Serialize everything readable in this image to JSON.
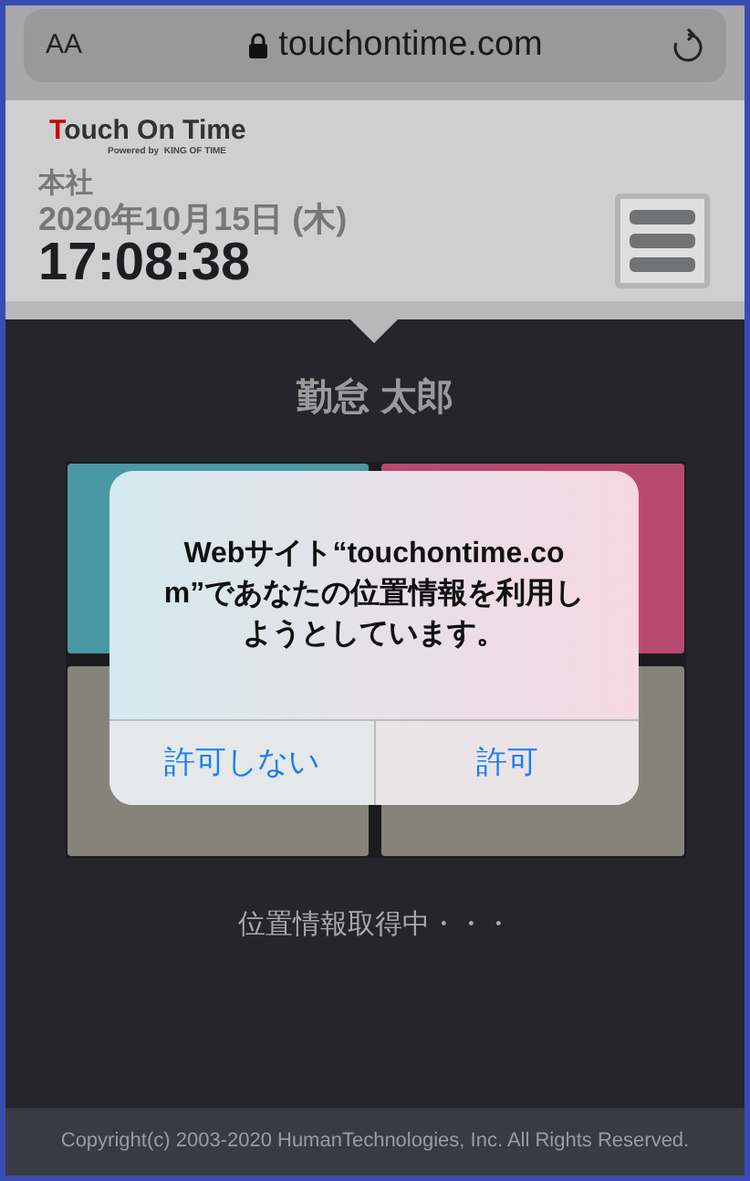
{
  "browser_bar": {
    "text_size_label": "AA",
    "url": "touchontime.com"
  },
  "header": {
    "logo": "Touch On Time",
    "logo_tagline": "Powered by  KING OF TIME",
    "location": "本社",
    "date": "2020年10月15日 (木)",
    "time": "17:08:38"
  },
  "employee_name": "勤怠 太郎",
  "tiles": [
    {
      "color": "#4a98a4"
    },
    {
      "color": "#b84a70"
    },
    {
      "color": "#86847a"
    },
    {
      "color": "#86847a"
    }
  ],
  "alert": {
    "message": "Webサイト“touchontime.com”であなたの位置情報を利用しようとしています。",
    "buttons": [
      "許可しない",
      "許可"
    ]
  },
  "status": "位置情報取得中・・・",
  "footer": "Copyright(c) 2003-2020 HumanTechnologies, Inc. All Rights Reserved."
}
